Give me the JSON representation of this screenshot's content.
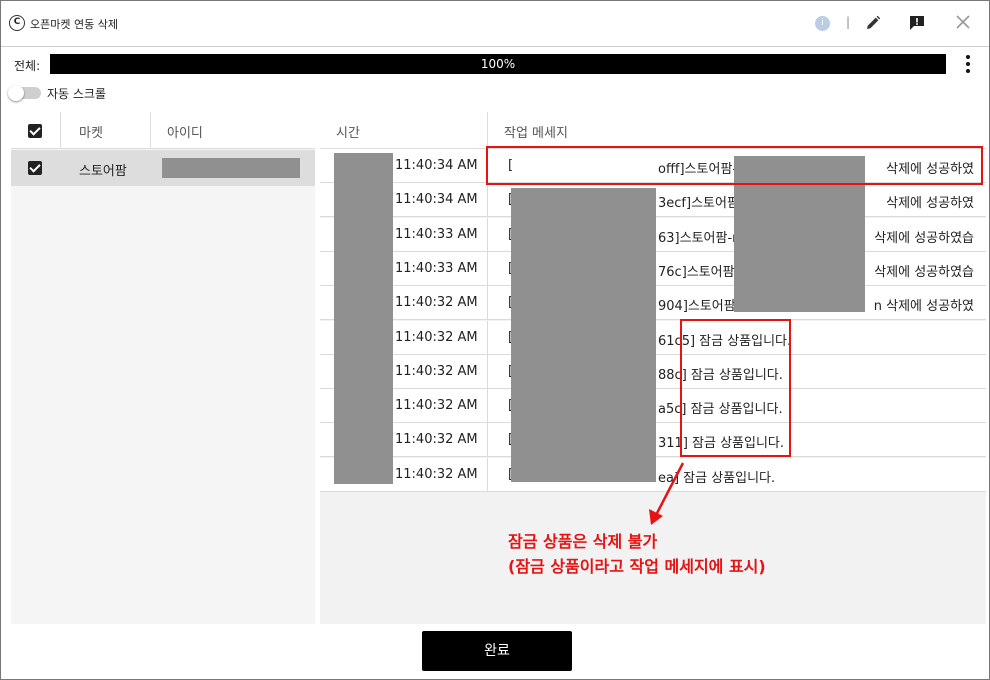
{
  "window": {
    "title": "오픈마켓 연동 삭제",
    "app_icon_glyph": "C",
    "info_icon_glyph": "i",
    "separator": "|"
  },
  "progress": {
    "label": "전체:",
    "percent": 100,
    "text": "100%"
  },
  "auto_scroll": {
    "label": "자동 스크롤",
    "enabled": false
  },
  "market_table": {
    "columns": [
      "마켓",
      "아이디"
    ],
    "rows": [
      {
        "checked": true,
        "market": "스토어팜"
      }
    ]
  },
  "log_table": {
    "columns": [
      "시간",
      "작업 메세지"
    ],
    "rows": [
      {
        "time": "11:40:34 AM",
        "msg_head": "[",
        "msg_mid": "offf]스토어팜-",
        "msg_tail": "삭제에 성공하였"
      },
      {
        "time": "11:40:34 AM",
        "msg_head": "[",
        "msg_mid": "3ecf]스토어팜-",
        "msg_tail": "삭제에 성공하였"
      },
      {
        "time": "11:40:33 AM",
        "msg_head": "[",
        "msg_mid": "63]스토어팜-ra",
        "msg_tail": "삭제에 성공하였습"
      },
      {
        "time": "11:40:33 AM",
        "msg_head": "[",
        "msg_mid": "76c]스토어팜-",
        "msg_tail": "삭제에 성공하였습"
      },
      {
        "time": "11:40:32 AM",
        "msg_head": "[",
        "msg_mid": "904]스토어팜",
        "msg_tail": "n 삭제에 성공하였"
      },
      {
        "time": "11:40:32 AM",
        "msg_head": "[",
        "msg_mid": "61c5] 잠금 상품입니다.",
        "msg_tail": ""
      },
      {
        "time": "11:40:32 AM",
        "msg_head": "[",
        "msg_mid": "88c] 잠금 상품입니다.",
        "msg_tail": ""
      },
      {
        "time": "11:40:32 AM",
        "msg_head": "[",
        "msg_mid": "a5c] 잠금 상품입니다.",
        "msg_tail": ""
      },
      {
        "time": "11:40:32 AM",
        "msg_head": "[",
        "msg_mid": "311] 잠금 상품입니다.",
        "msg_tail": ""
      },
      {
        "time": "11:40:32 AM",
        "msg_head": "[",
        "msg_mid": "ea] 잠금 상품입니다.",
        "msg_tail": ""
      }
    ]
  },
  "annotation": {
    "line1": "잠금 상품은 삭제 불가",
    "line2": "(잠금 상품이라고 작업 메세지에 표시)",
    "color": "#e41414"
  },
  "done_button": {
    "label": "완료"
  }
}
